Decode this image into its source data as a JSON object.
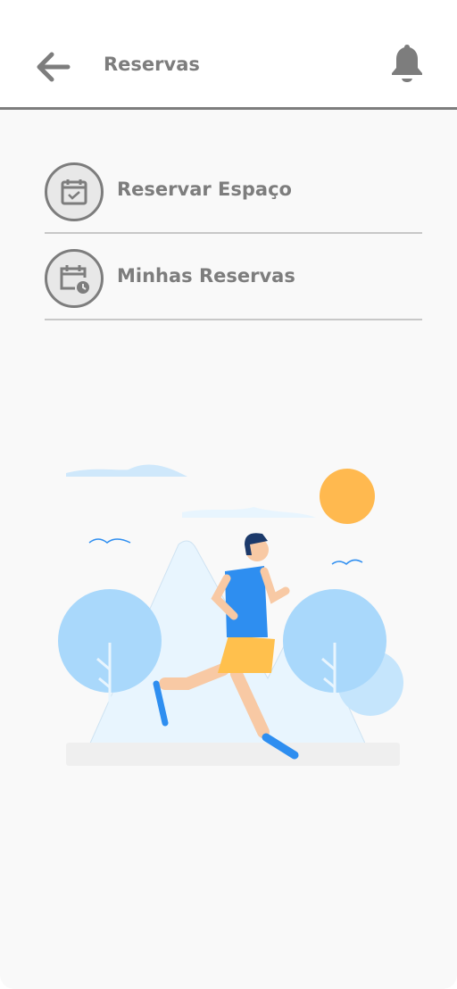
{
  "header": {
    "title": "Reservas",
    "back_icon": "arrow-left-icon",
    "notification_icon": "bell-icon"
  },
  "menu": [
    {
      "label": "Reservar Espaço",
      "icon": "calendar-check-icon"
    },
    {
      "label": "Minhas Reservas",
      "icon": "calendar-clock-icon"
    }
  ],
  "colors": {
    "text": "#7d7d7d",
    "divider": "#c8c8c8",
    "sun": "#ffb94f",
    "tree": "#a9d8fb",
    "shirt": "#2e8ef0",
    "shorts": "#ffc04d"
  }
}
